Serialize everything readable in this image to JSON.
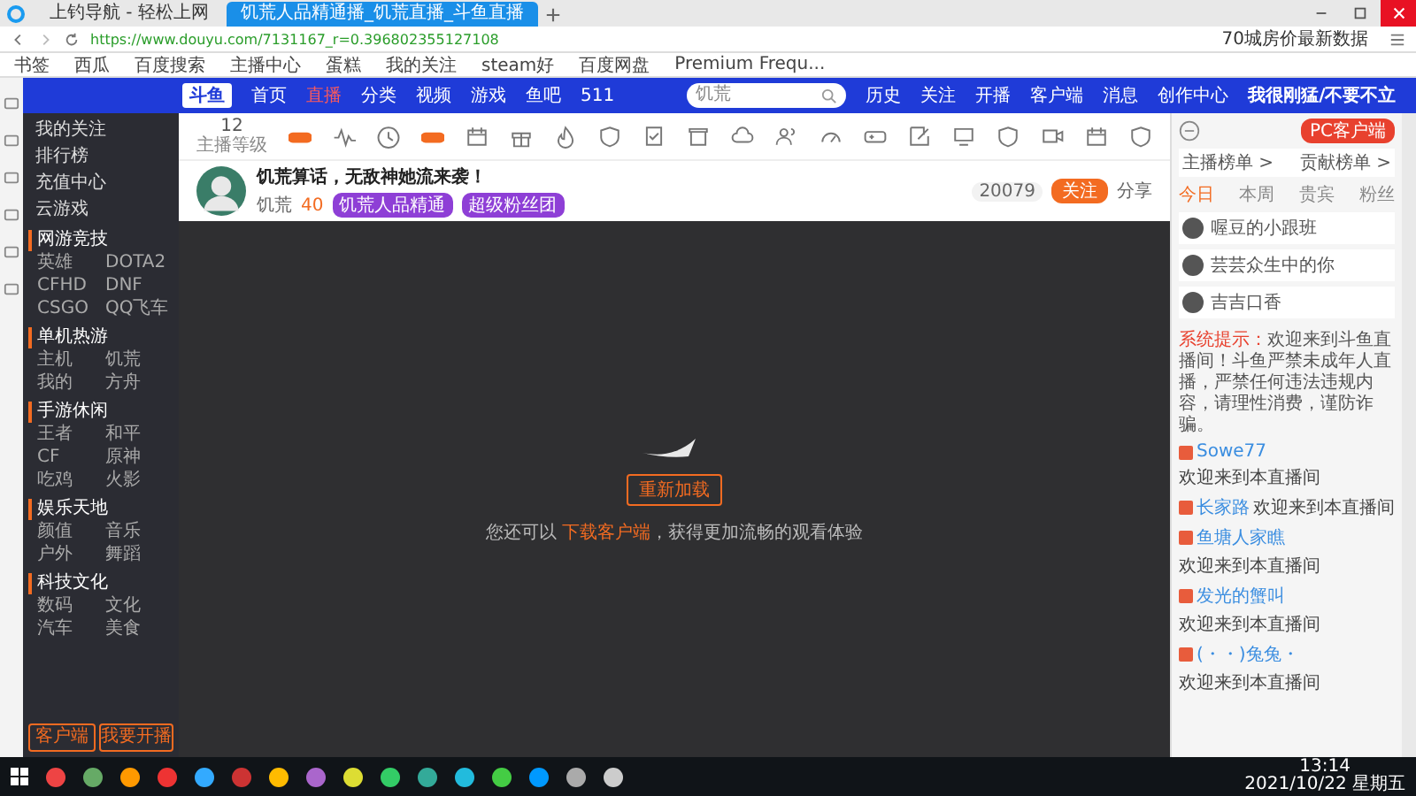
{
  "browser": {
    "tabs": [
      {
        "title": "上钓导航 - 轻松上网",
        "selected": false
      },
      {
        "title": "饥荒人品精通播_饥荒直播_斗鱼直播",
        "selected": true
      }
    ],
    "url": "https://www.douyu.com/7131167_r=0.396802355127108",
    "search_text": "70城房价最新数据",
    "bookmarks": [
      "书签",
      "西瓜",
      "百度搜索",
      "主播中心",
      "蛋糕",
      "我的关注",
      "steam好",
      "百度网盘",
      "Premium Frequ..."
    ]
  },
  "site_nav": {
    "logo": "斗鱼",
    "items": [
      {
        "label": "首页",
        "selected": false
      },
      {
        "label": "直播",
        "selected": true
      },
      {
        "label": "分类",
        "selected": false
      },
      {
        "label": "视频",
        "selected": false
      },
      {
        "label": "游戏",
        "selected": false
      },
      {
        "label": "鱼吧",
        "selected": false
      },
      {
        "label": "511",
        "selected": false
      }
    ],
    "search_placeholder": "饥荒",
    "actions": [
      "历史",
      "关注",
      "开播",
      "客户端",
      "消息",
      "创作中心"
    ],
    "banner": "我很刚猛/不要不立"
  },
  "sidebar": {
    "items": [
      "我的关注",
      "排行榜",
      "充值中心",
      "云游戏"
    ],
    "sections": [
      {
        "title": "网游竞技",
        "items": [
          "英雄",
          "DOTA2",
          "CFHD",
          "DNF",
          "CSGO",
          "QQ飞车"
        ]
      },
      {
        "title": "单机热游",
        "items": [
          "主机",
          "饥荒",
          "我的",
          "方舟"
        ]
      },
      {
        "title": "手游休闲",
        "items": [
          "王者",
          "和平",
          "CF",
          "原神",
          "吃鸡",
          "火影"
        ]
      },
      {
        "title": "娱乐天地",
        "items": [
          "颜值",
          "音乐",
          "户外",
          "舞蹈"
        ]
      },
      {
        "title": "科技文化",
        "items": [
          "数码",
          "文化",
          "汽车",
          "美食"
        ]
      }
    ],
    "buttons": [
      "客户端",
      "我要开播"
    ]
  },
  "toolbar": {
    "level": "12",
    "level_label": "主播等级",
    "tools": [
      {
        "kind": "toggle"
      },
      {
        "kind": "wave"
      },
      {
        "kind": "clock"
      },
      {
        "kind": "toggle"
      },
      {
        "kind": "calendar"
      },
      {
        "kind": "gift"
      },
      {
        "kind": "fire"
      },
      {
        "kind": "shield"
      },
      {
        "kind": "check"
      },
      {
        "kind": "box"
      },
      {
        "kind": "cloud"
      },
      {
        "kind": "people"
      },
      {
        "kind": "gauge"
      },
      {
        "kind": "game"
      },
      {
        "kind": "edit"
      },
      {
        "kind": "screen"
      },
      {
        "kind": "shield"
      },
      {
        "kind": "video"
      },
      {
        "kind": "calendar"
      },
      {
        "kind": "shield"
      }
    ]
  },
  "streamer": {
    "title": "饥荒算话，无敌神她流来袭！",
    "category": "饥荒",
    "hot": "40",
    "tags": [
      "饥荒人品精通",
      "超级粉丝团"
    ],
    "follow_count": "20079",
    "follow_label": "关注",
    "share": "分享"
  },
  "player": {
    "message": "您还可以 **下载客户端**，获得更加流畅的观看体验",
    "button": "重新加载"
  },
  "chat": {
    "pc_button": "PC客户端",
    "boards": [
      "主播榜单 >",
      "贡献榜单 >"
    ],
    "tabs": [
      {
        "label": "今日",
        "selected": true
      },
      {
        "label": "本周",
        "selected": false
      },
      {
        "label": "贵宾",
        "selected": false
      },
      {
        "label": "粉丝",
        "selected": false
      }
    ],
    "ranks": [
      {
        "name": "喔豆的小跟班"
      },
      {
        "name": "芸芸众生中的你"
      },
      {
        "name": "吉吉口香"
      }
    ],
    "notice": {
      "label": "系统提示：",
      "text": "欢迎来到斗鱼直播间！斗鱼严禁未成年人直播，严禁任何违法违规内容，请理性消费，谨防诈骗。"
    },
    "messages": [
      {
        "name": "Sowe77",
        "text": "欢迎来到本直播间"
      },
      {
        "name": "长家路",
        "text": "欢迎来到本直播间"
      },
      {
        "name": "鱼塘人家瞧",
        "text": "欢迎来到本直播间"
      },
      {
        "name": "发光的蟹叫",
        "text": "欢迎来到本直播间"
      },
      {
        "name": "(・・)兔兔・",
        "text": "欢迎来到本直播间"
      }
    ]
  },
  "taskbar": {
    "time": "13:14",
    "date": "2021/10/22 星期五"
  }
}
